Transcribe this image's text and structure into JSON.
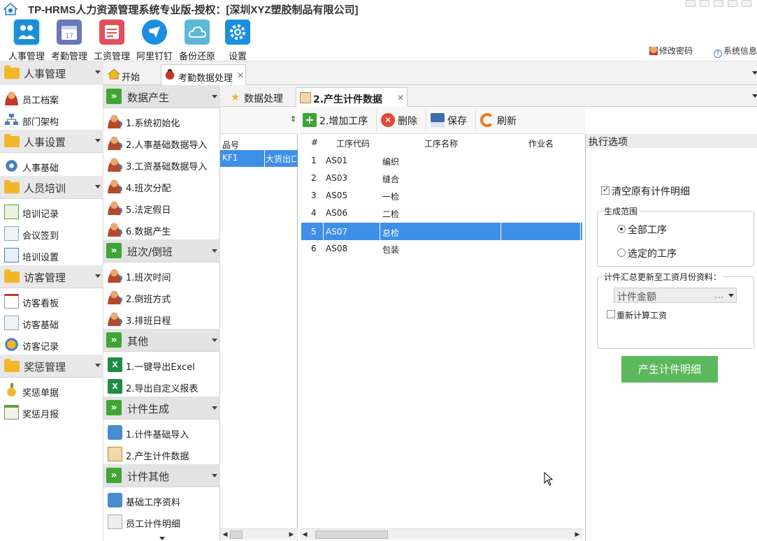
{
  "window": {
    "title": "TP-HRMS人力资源管理系统专业版-授权：[深圳XYZ塑胶制品有限公司]"
  },
  "modules": [
    {
      "label": "人事管理",
      "icon": "people-icon",
      "color": "#1b8fd6"
    },
    {
      "label": "考勤管理",
      "icon": "calendar-icon",
      "color": "#6a77b8"
    },
    {
      "label": "工资管理",
      "icon": "payroll-icon",
      "color": "#e0505c"
    },
    {
      "label": "阿里钉钉",
      "icon": "dingtalk-icon",
      "color": "#1a8fe0"
    },
    {
      "label": "备份还原",
      "icon": "cloud-icon",
      "color": "#5cb8d8"
    },
    {
      "label": "设置",
      "icon": "gear-icon",
      "color": "#1a8fe0"
    }
  ],
  "top_links": {
    "change_password": "修改密码",
    "system_info": "系统信息"
  },
  "nav1": {
    "groups": [
      {
        "label": "人事管理",
        "items": [
          "员工档案",
          "部门架构"
        ]
      },
      {
        "label": "人事设置",
        "items": [
          "人事基础"
        ]
      },
      {
        "label": "人员培训",
        "items": [
          "培训记录",
          "会议签到",
          "培训设置"
        ]
      },
      {
        "label": "访客管理",
        "items": [
          "访客看板",
          "访客基础",
          "访客记录"
        ]
      },
      {
        "label": "奖惩管理",
        "items": [
          "奖惩单据",
          "奖惩月报"
        ]
      }
    ]
  },
  "nav2": {
    "groups": [
      {
        "label": "数据产生",
        "items": [
          "1.系统初始化",
          "2.人事基础数据导入",
          "3.工资基础数据导入",
          "4.班次分配",
          "5.法定假日",
          "6.数据产生"
        ]
      },
      {
        "label": "班次/倒班",
        "items": [
          "1.班次时间",
          "2.倒班方式",
          "3.排班日程"
        ]
      },
      {
        "label": "其他",
        "items": [
          "1.一键导出Excel",
          "2.导出自定义报表"
        ]
      },
      {
        "label": "计件生成",
        "items": [
          "1.计件基础导入",
          "2.产生计件数据"
        ]
      },
      {
        "label": "计件其他",
        "items": [
          "基础工序资料",
          "员工计件明细"
        ]
      }
    ]
  },
  "tabs_outer": {
    "home": "开始",
    "attendance": "考勤数据处理"
  },
  "tabs_inner": {
    "data_processing": "数据处理",
    "piece_data": "2.产生计件数据"
  },
  "toolbar": {
    "add": "2.增加工序",
    "delete": "删除",
    "save": "保存",
    "refresh": "刷新"
  },
  "product_panel": {
    "header": "品号",
    "row": {
      "code": "KF1",
      "name": "大货出口"
    }
  },
  "grid": {
    "columns": [
      "#",
      "工序代码",
      "工序名称",
      "作业名"
    ],
    "rows": [
      {
        "n": "1",
        "code": "AS01",
        "name": "编织",
        "selected": false
      },
      {
        "n": "2",
        "code": "AS03",
        "name": "缝合",
        "selected": false
      },
      {
        "n": "3",
        "code": "AS05",
        "name": "一检",
        "selected": false
      },
      {
        "n": "4",
        "code": "AS06",
        "name": "二检",
        "selected": false
      },
      {
        "n": "5",
        "code": "AS07",
        "name": "总检",
        "selected": true
      },
      {
        "n": "6",
        "code": "AS08",
        "name": "包装",
        "selected": false
      }
    ]
  },
  "options": {
    "header": "执行选项",
    "clear_existing": "清空原有计件明细",
    "clear_existing_checked": true,
    "range_legend": "生成范围",
    "range_all": "全部工序",
    "range_selected": "选定的工序",
    "range_value": "all",
    "summary_legend": "计件汇总更新至工资月份资料：",
    "summary_select": "计件金额",
    "summary_select_more": "...",
    "recalc": "重新计算工资",
    "recalc_checked": false,
    "generate_button": "产生计件明细"
  },
  "colors": {
    "accent": "#3d8fe8",
    "success": "#5cb85c",
    "folder": "#f3b62a",
    "green_group": "#3fa535"
  }
}
